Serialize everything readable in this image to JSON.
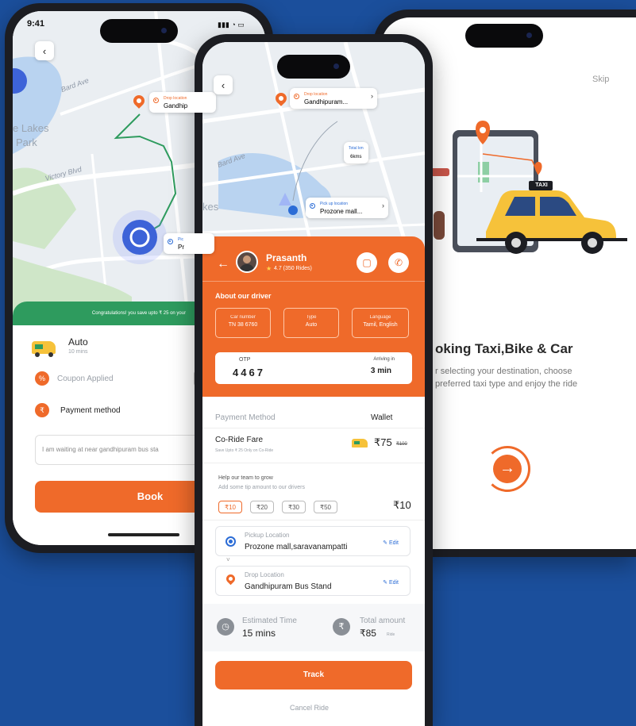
{
  "left_phone": {
    "status_time": "9:41",
    "map_labels": [
      "e Lakes",
      "Park",
      "Bard Ave",
      "Victory Blvd"
    ],
    "drop_pin": {
      "small": "Drop location",
      "text": "Gandhip"
    },
    "pickup_pin": {
      "small": "Pic",
      "text": "Pr"
    },
    "banner": "Congratulations! you save upto ₹ 25 on your",
    "vehicle": {
      "name": "Auto",
      "eta": "10 mins"
    },
    "coupon_label": "Coupon Applied",
    "payment_label": "Payment method",
    "message_placeholder": "I am waiting at near gandhipuram bus sta",
    "book_label": "Book"
  },
  "center_phone": {
    "map_labels": [
      "Bard Ave",
      "kes"
    ],
    "drop_card": {
      "small": "Drop location",
      "text": "Gandhipuram..."
    },
    "pickup_card": {
      "small": "Pick up location",
      "text": "Prozone mall..."
    },
    "distance_card": {
      "small": "Total km",
      "text": "6kms"
    },
    "driver": {
      "name": "Prasanth",
      "rating": "4.7 (350 Rides)"
    },
    "about_title": "About our driver",
    "info": [
      {
        "label": "Car number",
        "value": "TN 38 6760"
      },
      {
        "label": "Type",
        "value": "Auto"
      },
      {
        "label": "Language",
        "value": "Tamil, English"
      }
    ],
    "otp": {
      "label": "OTP",
      "value": "4467"
    },
    "arriving": {
      "label": "Arriving in",
      "value": "3 min"
    },
    "payment_method": {
      "label": "Payment Method",
      "value": "Wallet"
    },
    "fare": {
      "title": "Co-Ride Fare",
      "subtitle": "Save Upto ₹ 25 Only on Co-Ride",
      "price": "₹75",
      "old_price": "₹100"
    },
    "tip": {
      "title": "Help our team to grow",
      "subtitle": "Add some tip amount to our drivers",
      "options": [
        "₹10",
        "₹20",
        "₹30",
        "₹50"
      ],
      "selected": "₹10"
    },
    "pickup": {
      "label": "Pickup Location",
      "value": "Prozone mall,saravanampatti",
      "edit": "Edit"
    },
    "drop": {
      "label": "Drop Location",
      "value": "Gandhipuram Bus Stand",
      "edit": "Edit"
    },
    "estimated": {
      "label": "Estimated Time",
      "value": "15 mins"
    },
    "total": {
      "label": "Total amount",
      "value": "₹85",
      "note": "Ride"
    },
    "track_label": "Track",
    "cancel_label": "Cancel Ride"
  },
  "right_phone": {
    "skip_label": "Skip",
    "taxi_sign": "TAXI",
    "heading": "oking Taxi,Bike & Car",
    "desc_line1": "r selecting your destination, choose",
    "desc_line2": "preferred taxi type and enjoy the ride"
  },
  "colors": {
    "brand": "#ef6a2a",
    "background": "#1b4f9c",
    "taxi": "#f6c23a"
  }
}
